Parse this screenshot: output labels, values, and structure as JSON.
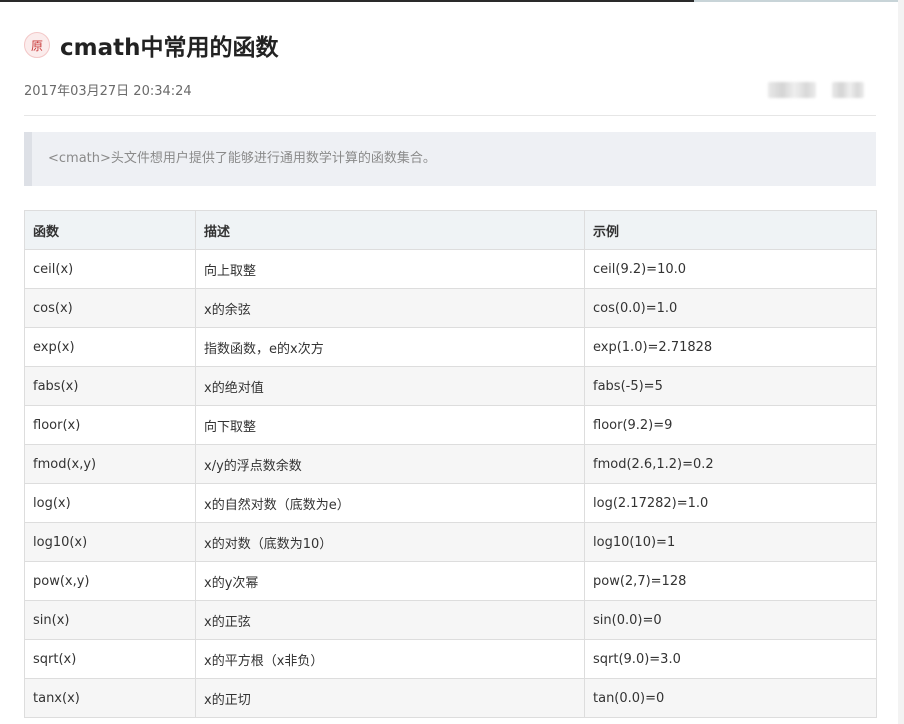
{
  "article": {
    "badge": "原",
    "title": "cmath中常用的函数",
    "date": "2017年03月27日 20:34:24",
    "quote": "<cmath>头文件想用户提供了能够进行通用数学计算的函数集合。"
  },
  "table": {
    "headers": [
      "函数",
      "描述",
      "示例"
    ],
    "rows": [
      [
        "ceil(x)",
        "向上取整",
        "ceil(9.2)=10.0"
      ],
      [
        "cos(x)",
        "x的余弦",
        "cos(0.0)=1.0"
      ],
      [
        "exp(x)",
        "指数函数，e的x次方",
        "exp(1.0)=2.71828"
      ],
      [
        "fabs(x)",
        "x的绝对值",
        "fabs(-5)=5"
      ],
      [
        "floor(x)",
        "向下取整",
        "floor(9.2)=9"
      ],
      [
        "fmod(x,y)",
        "x/y的浮点数余数",
        "fmod(2.6,1.2)=0.2"
      ],
      [
        "log(x)",
        "x的自然对数（底数为e）",
        "log(2.17282)=1.0"
      ],
      [
        "log10(x)",
        "x的对数（底数为10）",
        "log10(10)=1"
      ],
      [
        "pow(x,y)",
        "x的y次幂",
        "pow(2,7)=128"
      ],
      [
        "sin(x)",
        "x的正弦",
        "sin(0.0)=0"
      ],
      [
        "sqrt(x)",
        "x的平方根（x非负）",
        "sqrt(9.0)=3.0"
      ],
      [
        "tanx(x)",
        "x的正切",
        "tan(0.0)=0"
      ]
    ]
  }
}
